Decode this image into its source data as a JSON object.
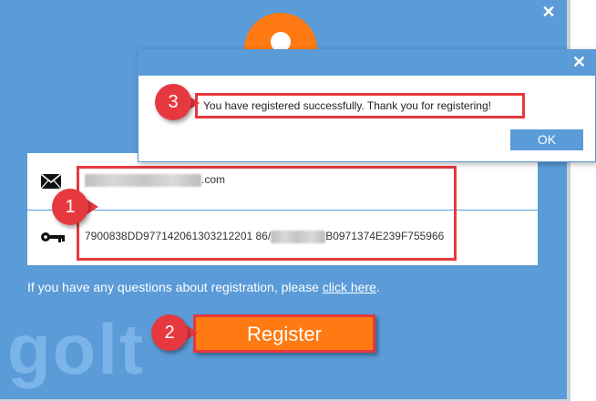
{
  "window": {
    "close_label": "✕"
  },
  "form": {
    "email_suffix": ".com",
    "key_prefix": "7900838DD977142061303212201 86/",
    "key_suffix": "B0971374E239F755966"
  },
  "help": {
    "text": "If you have any questions about registration, please ",
    "link": "click here",
    "period": "."
  },
  "register": {
    "label": "Register"
  },
  "badges": {
    "one": "1",
    "two": "2",
    "three": "3"
  },
  "dialog": {
    "close_label": "✕",
    "message": "You have registered successfully. Thank you for registering!",
    "ok_label": "OK"
  },
  "watermark": {
    "text": "golt"
  },
  "colors": {
    "window_blue": "#5a9bd8",
    "accent_orange": "#ff7a12",
    "highlight_red": "#e6393f"
  },
  "icons": {
    "mail": "mail-icon",
    "key": "key-icon",
    "avatar": "user-icon"
  }
}
